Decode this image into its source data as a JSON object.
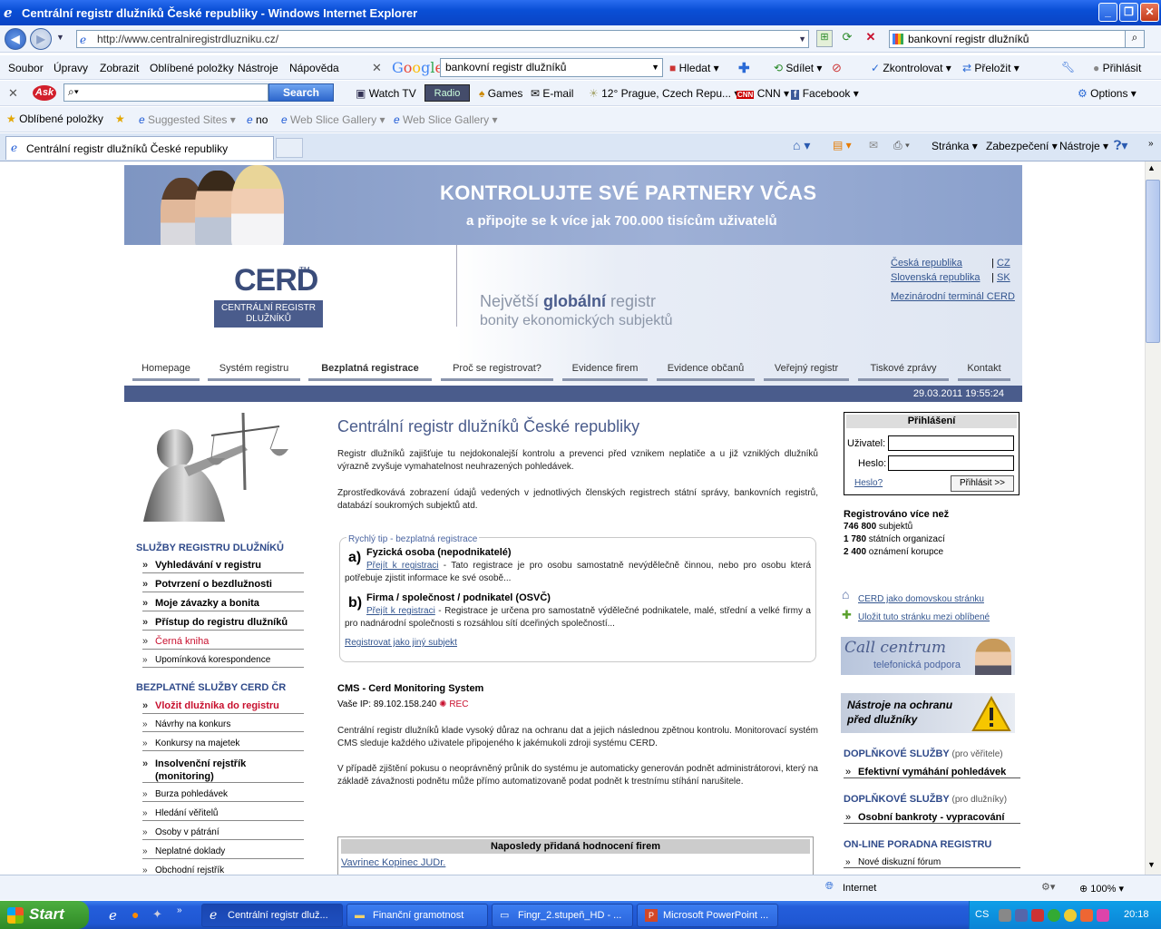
{
  "window": {
    "title": "Centrální registr dlužníků České republiky - Windows Internet Explorer"
  },
  "addressbar": {
    "url": "http://www.centralniregistrdluzniku.cz/",
    "search_value": "bankovní registr dlužníků"
  },
  "menu": {
    "items": [
      "Soubor",
      "Úpravy",
      "Zobrazit",
      "Oblíbené položky",
      "Nástroje",
      "Nápověda"
    ]
  },
  "google_toolbar": {
    "query": "bankovní registr dlužníků",
    "search": "Hledat",
    "share": "Sdílet",
    "check": "Zkontrolovat",
    "translate": "Přeložit",
    "signin": "Přihlásit"
  },
  "ask_toolbar": {
    "search": "Search",
    "items": [
      "Watch TV",
      "Radio",
      "Games",
      "E-mail",
      "12° Prague, Czech Repu...",
      "CNN",
      "Facebook"
    ],
    "options": "Options"
  },
  "favorites_bar": {
    "label": "Oblíbené položky",
    "items": [
      "Suggested Sites",
      "no",
      "Web Slice Gallery",
      "Web Slice Gallery"
    ]
  },
  "tab": {
    "title": "Centrální registr dlužníků České republiky"
  },
  "command_bar": {
    "page": "Stránka",
    "security": "Zabezpečení",
    "tools": "Nástroje"
  },
  "site": {
    "banner": {
      "line1": "KONTROLUJTE SVÉ PARTNERY VČAS",
      "line2": "a připojte se k více jak 700.000 tisícům uživatelů"
    },
    "logo": {
      "name": "CERD",
      "tm": "TM",
      "sub1": "CENTRÁLNÍ REGISTR",
      "sub2": "DLUŽNÍKŮ"
    },
    "tagline": {
      "l1_a": "Největší ",
      "l1_b": "globální",
      "l1_c": " registr",
      "l2": "bonity ekonomických subjektů"
    },
    "lang": [
      {
        "name": "Česká republika",
        "code": "CZ"
      },
      {
        "name": "Slovenská republika",
        "code": "SK"
      }
    ],
    "terminal": "Mezinárodní terminál CERD",
    "nav": [
      "Homepage",
      "Systém registru",
      "Bezplatná registrace",
      "Proč se registrovat?",
      "Evidence firem",
      "Evidence občanů",
      "Veřejný registr",
      "Tiskové zprávy",
      "Kontakt"
    ],
    "datetime": "29.03.2011 19:55:24",
    "left": {
      "head1": "SLUŽBY REGISTRU DLUŽNÍKŮ",
      "services": [
        "Vyhledávání v registru",
        "Potvrzení o bezdlužnosti",
        "Moje závazky a bonita",
        "Přístup do registru dlužníků",
        "Černá kniha",
        "Upomínková korespondence"
      ],
      "head2": "BEZPLATNÉ SLUŽBY CERD ČR",
      "free": [
        "Vložit dlužníka do registru",
        "Návrhy na konkurs",
        "Konkursy na majetek",
        "Insolvenční rejstřík (monitoring)",
        "Burza pohledávek",
        "Hledání věřitelů",
        "Osoby v pátrání",
        "Neplatné doklady",
        "Obchodní rejstřík"
      ]
    },
    "center": {
      "title": "Centrální registr dlužníků České republiky",
      "p1": "Registr dlužníků zajišťuje tu nejdokonalejší kontrolu a prevenci před vznikem neplatiče a u již vzniklých dlužníků výrazně zvyšuje vymahatelnost neuhrazených pohledávek.",
      "p2": "Zprostředkovává zobrazení údajů vedených v jednotlivých členských registrech státní správy, bankovních registrů, databází soukromých subjektů atd.",
      "tip_title": "Rychlý tip - bezplatná registrace",
      "tip_a_letter": "a)",
      "tip_a_head": "Fyzická osoba (nepodnikatelé)",
      "tip_a_link": "Přejít k registraci",
      "tip_a_text": " - Tato registrace je pro osobu samostatně nevýdělečně činnou, nebo pro osobu která potřebuje zjistit informace ke své osobě...",
      "tip_b_letter": "b)",
      "tip_b_head": "Firma / společnost / podnikatel (OSVČ)",
      "tip_b_link": "Přejít k registraci",
      "tip_b_text": " - Registrace je určena pro samostatně výdělečné podnikatele, malé, střední a velké firmy a pro nadnárodní společnosti s rozsáhlou sítí dceřiných společností...",
      "tip_other": "Registrovat jako jiný subjekt",
      "cms_title": "CMS - Cerd Monitoring System",
      "cms_ip": "Vaše IP: 89.102.158.240",
      "cms_rec": "REC",
      "p3": "Centrální registr dlužníků klade vysoký důraz na ochranu dat a jejich následnou zpětnou kontrolu. Monitorovací systém CMS sleduje každého uživatele připojeného k jakémukoli zdroji systému CERD.",
      "p4": "V případě zjištění pokusu o neoprávněný průnik do systému je automaticky generován podnět administrátorovi, který na základě závažnosti podnětu může přímo automatizovaně podat podnět k trestnímu stíhání narušitele.",
      "ratings_head": "Naposledy přidaná hodnocení firem",
      "ratings_first": "Vavrinec Kopinec JUDr."
    },
    "right": {
      "login_head": "Přihlášení",
      "user_label": "Uživatel:",
      "pass_label": "Heslo:",
      "forgot": "Heslo?",
      "login_btn": "Přihlásit >>",
      "reg_head": "Registrováno více než",
      "reg1_num": "746 800",
      "reg1_txt": " subjektů",
      "reg2_num": "1 780",
      "reg2_txt": " státních organizací",
      "reg3_num": "2 400",
      "reg3_txt": " oznámení korupce",
      "home_link": "CERD jako domovskou stránku",
      "fav_link": "Uložit tuto stránku mezi oblíbené",
      "call1": "Call centrum",
      "call2": "telefonická podpora",
      "tools1": "Nástroje na ochranu",
      "tools2": "před dlužníky",
      "add1_head": "DOPLŇKOVÉ SLUŽBY",
      "add1_sub": " (pro věřitele)",
      "add1_item": "Efektivní vymáhání pohledávek",
      "add2_head": "DOPLŇKOVÉ SLUŽBY",
      "add2_sub": " (pro dlužníky)",
      "add2_item": "Osobní bankroty - vypracování",
      "online_head": "ON-LINE PORADNA REGISTRU",
      "online_item": "Nové diskuzní fórum"
    }
  },
  "statusbar": {
    "zone": "Internet",
    "zoom": "100%"
  },
  "taskbar": {
    "start": "Start",
    "items": [
      "Centrální registr dluž...",
      "Finanční gramotnost",
      "Fingr_2.stupeň_HD - ...",
      "Microsoft PowerPoint ..."
    ],
    "lang": "CS",
    "clock": "20:18"
  },
  "colors": {
    "brand": "#4a5c8c",
    "title": "#0a4fd6",
    "link": "#33558f",
    "accent_red": "#c8102e"
  }
}
